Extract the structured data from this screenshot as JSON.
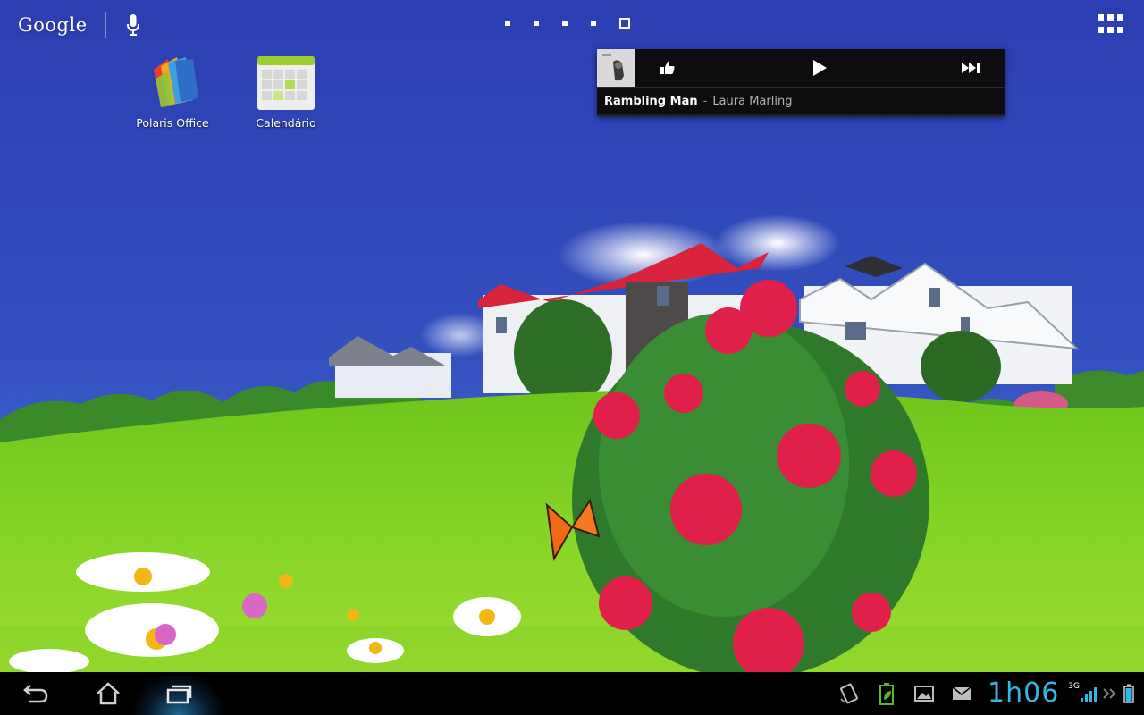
{
  "topbar": {
    "search_brand": "Google",
    "icons": {
      "mic": "mic-icon",
      "apps": "all-apps-icon"
    },
    "page_count": 5,
    "current_page": 5
  },
  "desktop": {
    "apps": [
      {
        "label": "Polaris Office",
        "icon": "polaris-office-icon"
      },
      {
        "label": "Calendário",
        "icon": "calendar-icon"
      }
    ]
  },
  "music_widget": {
    "track_title": "Rambling Man",
    "separator": "-",
    "artist": "Laura Marling",
    "icons": {
      "like": "thumbs-up-icon",
      "play": "play-icon",
      "next": "skip-next-icon"
    }
  },
  "navigation": {
    "icons": {
      "back": "back-icon",
      "home": "home-icon",
      "recent": "recent-apps-icon"
    }
  },
  "status_bar": {
    "clock": "1h06",
    "network_type": "3G",
    "icons": [
      "screen-rotation-icon",
      "battery-saver-icon",
      "gallery-icon",
      "email-icon",
      "signal-icon",
      "battery-icon"
    ]
  },
  "colors": {
    "clock": "#33b5e5",
    "sky": "#2f44b6",
    "grass": "#7cd21e",
    "nav_bg": "#000000",
    "widget_bg": "#0d0d10"
  }
}
